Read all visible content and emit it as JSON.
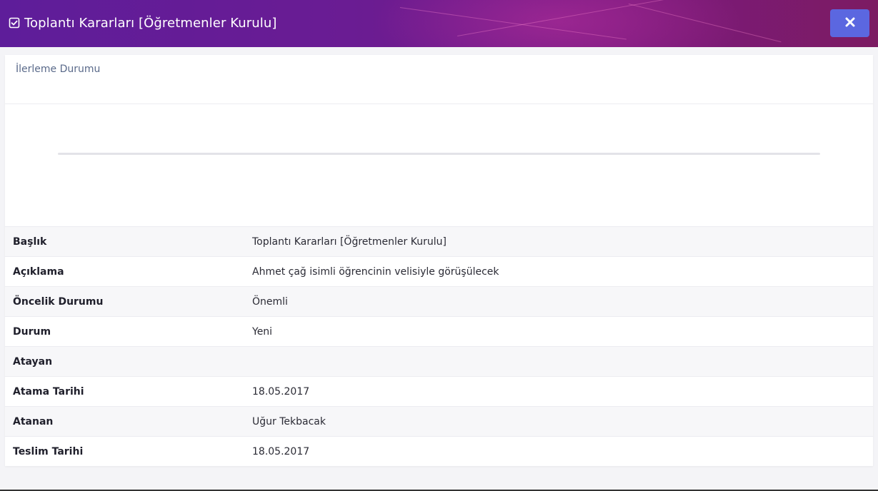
{
  "modal": {
    "title": "Toplantı Kararları [Öğretmenler Kurulu]",
    "title_icon": "checkbox-checked-icon",
    "close_icon": "close-icon"
  },
  "progress": {
    "section_title": "İlerleme Durumu",
    "value_percent": 0
  },
  "details": {
    "rows": [
      {
        "label": "Başlık",
        "value": "Toplantı Kararları [Öğretmenler Kurulu]"
      },
      {
        "label": "Açıklama",
        "value": "Ahmet çağ isimli öğrencinin velisiyle görüşülecek"
      },
      {
        "label": "Öncelik Durumu",
        "value": "Önemli"
      },
      {
        "label": "Durum",
        "value": "Yeni"
      },
      {
        "label": "Atayan",
        "value": ""
      },
      {
        "label": "Atama Tarihi",
        "value": "18.05.2017"
      },
      {
        "label": "Atanan",
        "value": "Uğur Tekbacak"
      },
      {
        "label": "Teslim Tarihi",
        "value": "18.05.2017"
      }
    ]
  },
  "colors": {
    "header_start": "#5e1d9a",
    "header_end": "#7c1b62",
    "close_button": "#5b67e0"
  }
}
